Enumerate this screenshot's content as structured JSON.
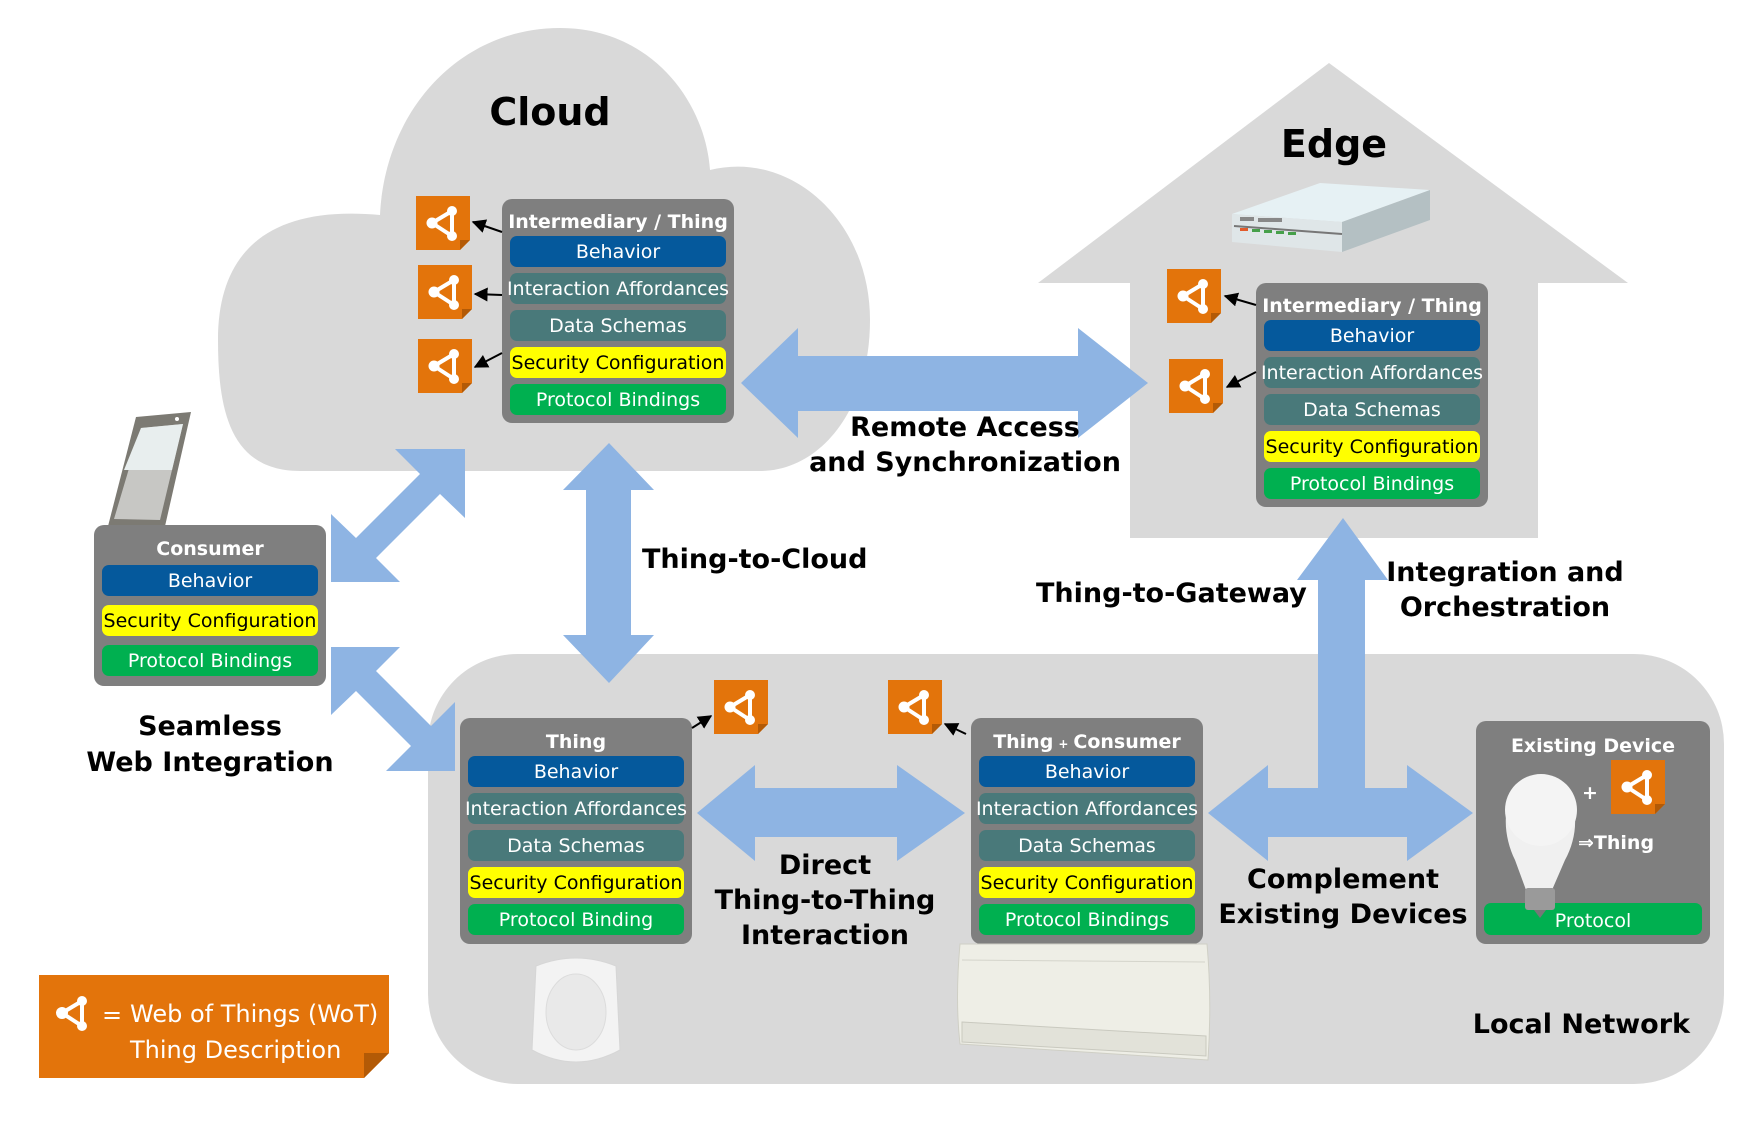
{
  "colors": {
    "region_bg": "#d9d9d9",
    "box_bg": "#7f7f7f",
    "behavior": "#05599c",
    "affordances": "#49797a",
    "schemas": "#49797a",
    "security": "#ffff00",
    "protocol": "#00b050",
    "arrow": "#8eb4e3",
    "td_icon": "#e3740b"
  },
  "regions": {
    "cloud": "Cloud",
    "edge": "Edge",
    "local_network": "Local Network"
  },
  "boxes": {
    "cloud": {
      "title": "Intermediary / Thing",
      "layers": [
        "Behavior",
        "Interaction Affordances",
        "Data Schemas",
        "Security Configuration",
        "Protocol Bindings"
      ]
    },
    "edge": {
      "title": "Intermediary / Thing",
      "layers": [
        "Behavior",
        "Interaction Affordances",
        "Data Schemas",
        "Security Configuration",
        "Protocol Bindings"
      ]
    },
    "consumer": {
      "title": "Consumer",
      "layers": [
        "Behavior",
        "Security Configuration",
        "Protocol Bindings"
      ]
    },
    "thing": {
      "title": "Thing",
      "layers": [
        "Behavior",
        "Interaction Affordances",
        "Data Schemas",
        "Security Configuration",
        "Protocol Binding"
      ]
    },
    "thing_consumer": {
      "title_a": "Thing",
      "title_plus": "+",
      "title_b": "Consumer",
      "layers": [
        "Behavior",
        "Interaction Affordances",
        "Data Schemas",
        "Security Configuration",
        "Protocol Bindings"
      ]
    },
    "existing": {
      "title": "Existing Device",
      "plus": "+",
      "result": "⇒Thing",
      "layers": [
        "Protocol"
      ]
    }
  },
  "labels": {
    "remote_1": "Remote Access",
    "remote_2": "and Synchronization",
    "thing_to_cloud": "Thing-to-Cloud",
    "thing_to_gateway": "Thing-to-Gateway",
    "integration_1": "Integration and",
    "integration_2": "Orchestration",
    "seamless_1": "Seamless",
    "seamless_2": "Web Integration",
    "direct_1": "Direct",
    "direct_2": "Thing-to-Thing",
    "direct_3": "Interaction",
    "complement_1": "Complement",
    "complement_2": "Existing Devices"
  },
  "legend": {
    "equals": "=",
    "line1": "Web of Things (WoT)",
    "line2": "Thing Description",
    "icon": "td-share-icon"
  }
}
